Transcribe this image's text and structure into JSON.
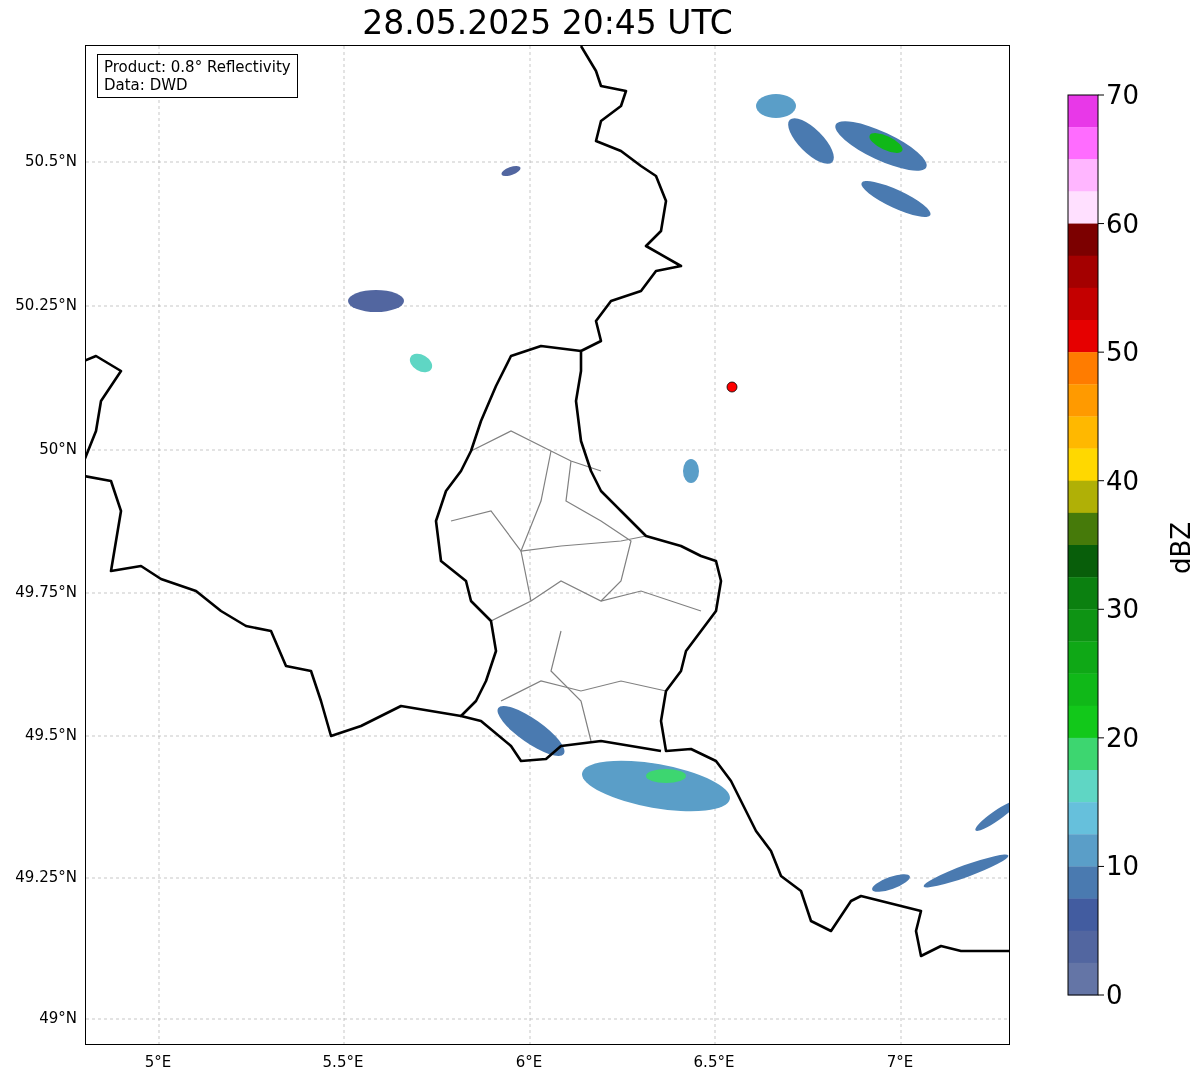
{
  "title": "28.05.2025 20:45 UTC",
  "info_box": [
    "Product: 0.8° Reflectivity",
    "Data: DWD"
  ],
  "y_ticks": [
    "50.5°N",
    "50.25°N",
    "50°N",
    "49.75°N",
    "49.5°N",
    "49.25°N",
    "49°N"
  ],
  "x_ticks": [
    "5°E",
    "5.5°E",
    "6°E",
    "6.5°E",
    "7°E"
  ],
  "colorbar": {
    "label": "dBZ",
    "ticks": [
      "70",
      "60",
      "50",
      "40",
      "30",
      "20",
      "10",
      "0"
    ],
    "segments": [
      {
        "color": "#e838e8"
      },
      {
        "color": "#ff6cff"
      },
      {
        "color": "#ffb6ff"
      },
      {
        "color": "#ffe0ff"
      },
      {
        "color": "#7c0000"
      },
      {
        "color": "#a40000"
      },
      {
        "color": "#c40000"
      },
      {
        "color": "#e60000"
      },
      {
        "color": "#ff7c00"
      },
      {
        "color": "#ff9a00"
      },
      {
        "color": "#ffb800"
      },
      {
        "color": "#ffd800"
      },
      {
        "color": "#b0b006"
      },
      {
        "color": "#467a0a"
      },
      {
        "color": "#085e0a"
      },
      {
        "color": "#0b8010"
      },
      {
        "color": "#0e9414"
      },
      {
        "color": "#0fa816"
      },
      {
        "color": "#10b818"
      },
      {
        "color": "#12c81a"
      },
      {
        "color": "#3dd670"
      },
      {
        "color": "#5fd6c4"
      },
      {
        "color": "#66c0dc"
      },
      {
        "color": "#5a9ec8"
      },
      {
        "color": "#4a7ab0"
      },
      {
        "color": "#425ca0"
      },
      {
        "color": "#5266a0"
      },
      {
        "color": "#6475a6"
      }
    ]
  }
}
